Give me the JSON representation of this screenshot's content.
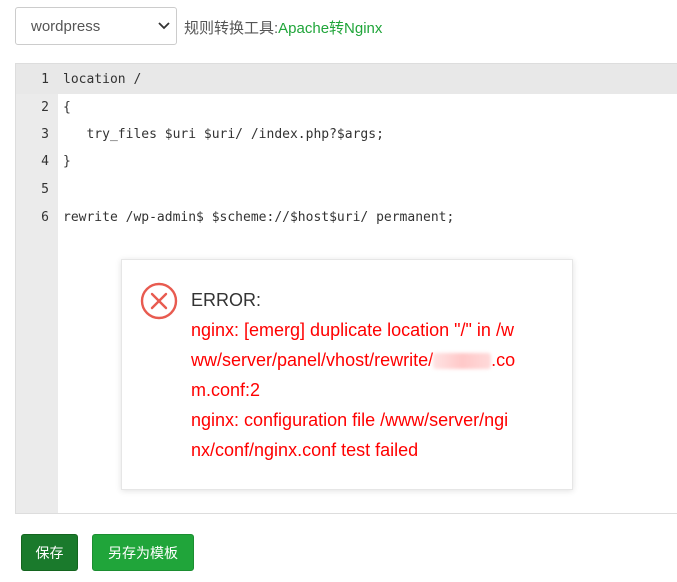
{
  "toolbar": {
    "select_value": "wordpress",
    "tool_label": "规则转换工具:",
    "tool_value": "Apache转Nginx"
  },
  "editor": {
    "lines": [
      {
        "num": "1",
        "text": "location /"
      },
      {
        "num": "2",
        "text": "{"
      },
      {
        "num": "3",
        "text": "   try_files $uri $uri/ /index.php?$args;"
      },
      {
        "num": "4",
        "text": "}"
      },
      {
        "num": "5",
        "text": ""
      },
      {
        "num": "6",
        "text": "rewrite /wp-admin$ $scheme://$host$uri/ permanent;"
      }
    ]
  },
  "modal": {
    "title": "ERROR:",
    "lines": [
      "nginx: [emerg] duplicate location \"/\" in /w",
      "ww/server/panel/vhost/rewrite/",
      ".co",
      "m.conf:2",
      "nginx: configuration file /www/server/ngi",
      "nx/conf/nginx.conf test failed"
    ]
  },
  "buttons": {
    "save": "保存",
    "save_template": "另存为模板"
  },
  "colors": {
    "accent_green": "#20a53a",
    "error_red": "#ff0000"
  }
}
